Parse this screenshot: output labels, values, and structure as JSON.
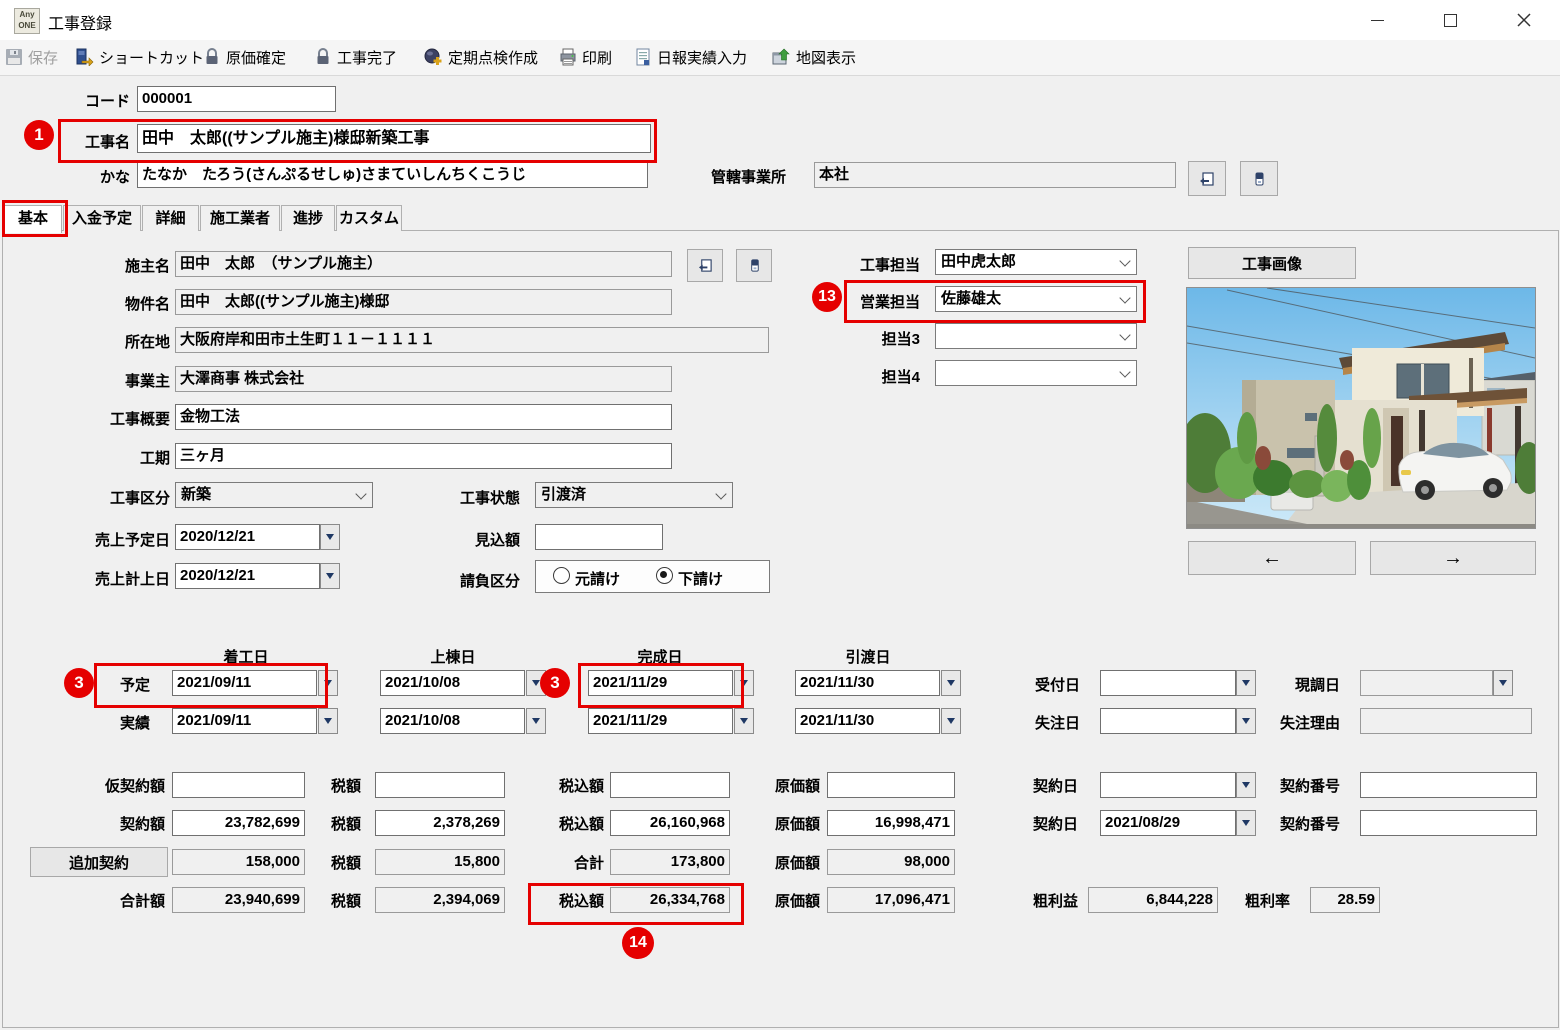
{
  "window": {
    "title": "工事登録",
    "logo_line1": "Any",
    "logo_line2": "ONE"
  },
  "toolbar": {
    "items": [
      {
        "label": "保存",
        "icon": "save-icon",
        "disabled": true
      },
      {
        "label": "ショートカット",
        "icon": "shortcut-icon"
      },
      {
        "label": "原価確定",
        "icon": "lock-icon"
      },
      {
        "label": "工事完了",
        "icon": "lock-icon"
      },
      {
        "label": "定期点検作成",
        "icon": "periodic-inspection-icon"
      },
      {
        "label": "印刷",
        "icon": "printer-icon"
      },
      {
        "label": "日報実績入力",
        "icon": "daily-report-icon"
      },
      {
        "label": "地図表示",
        "icon": "map-icon"
      }
    ]
  },
  "header": {
    "code_label": "コード",
    "code_value": "000001",
    "name_label": "工事名",
    "name_value": "田中　太郎((サンプル施主)様邸新築工事",
    "kana_label": "かな",
    "kana_value": "たなか　たろう(さんぷるせしゅ)さまていしんちくこうじ",
    "office_label": "管轄事業所",
    "office_value": "本社"
  },
  "tabs": [
    "基本",
    "入金予定",
    "詳細",
    "施工業者",
    "進捗",
    "カスタム"
  ],
  "form": {
    "owner": {
      "label": "施主名",
      "value": "田中　太郎　（サンプル施主）"
    },
    "property": {
      "label": "物件名",
      "value": "田中　太郎((サンプル施主)様邸"
    },
    "location": {
      "label": "所在地",
      "value": "大阪府岸和田市土生町１１－１１１１"
    },
    "business": {
      "label": "事業主",
      "value": "大澤商事 株式会社"
    },
    "summary": {
      "label": "工事概要",
      "value": "金物工法"
    },
    "period": {
      "label": "工期",
      "value": "三ヶ月"
    },
    "category": {
      "label": "工事区分",
      "value": "新築"
    },
    "status": {
      "label": "工事状態",
      "value": "引渡済"
    },
    "sales_planned_date": {
      "label": "売上予定日",
      "value": "2020/12/21"
    },
    "estimate": {
      "label": "見込額",
      "value": ""
    },
    "sales_recorded_date": {
      "label": "売上計上日",
      "value": "2020/12/21"
    },
    "contract_type": {
      "label": "請負区分",
      "opt1": "元請け",
      "opt2": "下請け",
      "selected": "下請け"
    },
    "manager1": {
      "label": "工事担当",
      "value": "田中虎太郎"
    },
    "manager2": {
      "label": "営業担当",
      "value": "佐藤雄太"
    },
    "manager3": {
      "label": "担当3",
      "value": ""
    },
    "manager4": {
      "label": "担当4",
      "value": ""
    }
  },
  "image_panel": {
    "button_label": "工事画像",
    "prev_label": "←",
    "next_label": "→"
  },
  "dates": {
    "headers": [
      "着工日",
      "上棟日",
      "完成日",
      "引渡日"
    ],
    "planned_label": "予定",
    "actual_label": "実績",
    "planned": [
      "2021/09/11",
      "2021/10/08",
      "2021/11/29",
      "2021/11/30"
    ],
    "actual": [
      "2021/09/11",
      "2021/10/08",
      "2021/11/29",
      "2021/11/30"
    ],
    "reception": {
      "label": "受付日",
      "value": ""
    },
    "survey": {
      "label": "現調日",
      "value": ""
    },
    "lost": {
      "label": "失注日",
      "value": ""
    },
    "lost_reason": {
      "label": "失注理由",
      "value": ""
    }
  },
  "money": {
    "r1": {
      "label": "仮契約額",
      "amount": "",
      "tax_label": "税額",
      "tax": "",
      "incl_label": "税込額",
      "incl": "",
      "cost_label": "原価額",
      "cost": ""
    },
    "r2": {
      "label": "契約額",
      "amount": "23,782,699",
      "tax_label": "税額",
      "tax": "2,378,269",
      "incl_label": "税込額",
      "incl": "26,160,968",
      "cost_label": "原価額",
      "cost": "16,998,471"
    },
    "r3": {
      "label": "追加契約",
      "amount": "158,000",
      "tax_label": "税額",
      "tax": "15,800",
      "incl_label": "合計",
      "incl": "173,800",
      "cost_label": "原価額",
      "cost": "98,000"
    },
    "r4": {
      "label": "合計額",
      "amount": "23,940,699",
      "tax_label": "税額",
      "tax": "2,394,069",
      "incl_label": "税込額",
      "incl": "26,334,768",
      "cost_label": "原価額",
      "cost": "17,096,471"
    },
    "contract_date_label": "契約日",
    "contract_date_r1": "",
    "contract_date_r2": "2021/08/29",
    "contract_no_label": "契約番号",
    "contract_no_r1": "",
    "contract_no_r2": "",
    "gross_profit_label": "粗利益",
    "gross_profit": "6,844,228",
    "gross_margin_label": "粗利率",
    "gross_margin": "28.59"
  },
  "annotations": {
    "c1": "1",
    "c3a": "3",
    "c3b": "3",
    "c13": "13",
    "c14": "14"
  },
  "colors": {
    "annotation_red": "#e50000",
    "readonly_bg": "#f0f0f0",
    "field_border": "#707070",
    "accent_navy": "#1f3864"
  }
}
